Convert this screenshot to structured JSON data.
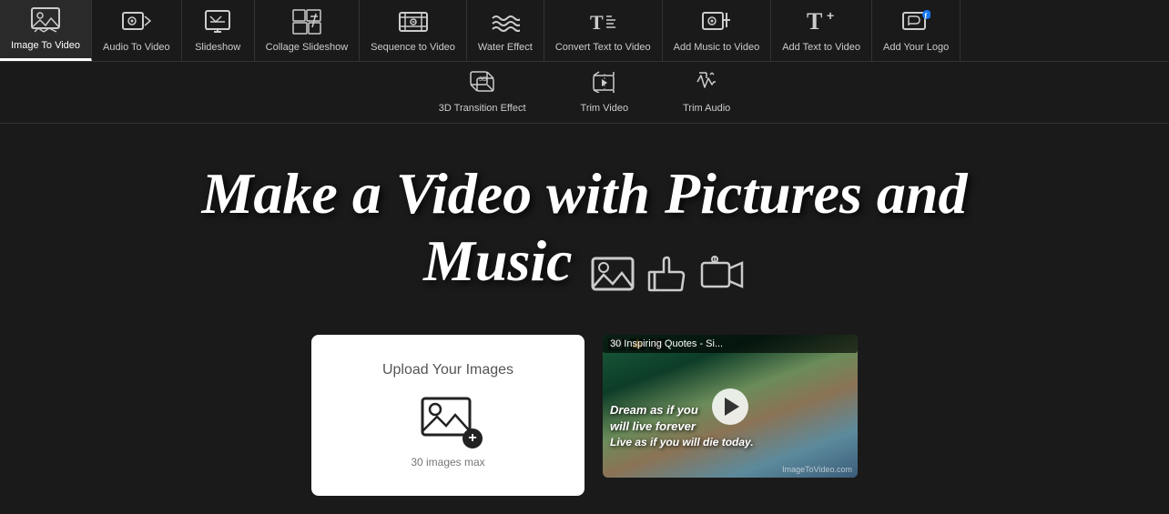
{
  "nav": {
    "items": [
      {
        "id": "image-to-video",
        "label": "Image To Video",
        "icon": "🖼",
        "active": true
      },
      {
        "id": "audio-to-video",
        "label": "Audio To Video",
        "icon": "🎵"
      },
      {
        "id": "slideshow",
        "label": "Slideshow",
        "icon": "📊"
      },
      {
        "id": "collage-slideshow",
        "label": "Collage Slideshow",
        "icon": "📋"
      },
      {
        "id": "sequence-to-video",
        "label": "Sequence to Video",
        "icon": "🎞"
      },
      {
        "id": "water-effect",
        "label": "Water Effect",
        "icon": "〰"
      },
      {
        "id": "convert-text",
        "label": "Convert Text to Video",
        "icon": "📝"
      },
      {
        "id": "add-music",
        "label": "Add Music to Video",
        "icon": "🎵"
      },
      {
        "id": "add-text",
        "label": "Add Text to Video",
        "icon": "T"
      },
      {
        "id": "add-logo",
        "label": "Add Your Logo",
        "icon": "🏷"
      }
    ]
  },
  "second_nav": {
    "items": [
      {
        "id": "3d-transition",
        "label": "3D Transition Effect",
        "icon": "✦"
      },
      {
        "id": "trim-video",
        "label": "Trim Video",
        "icon": "✂"
      },
      {
        "id": "trim-audio",
        "label": "Trim Audio",
        "icon": "🎼"
      }
    ]
  },
  "hero": {
    "title_line1": "Make a Video with Pictures and",
    "title_line2": "Music"
  },
  "upload": {
    "label": "Upload Your Images",
    "limit": "30 images max"
  },
  "video_preview": {
    "title": "30 Inspiring Quotes - Si...",
    "quote_line1": "Dream as if you",
    "quote_line2": "will live forever",
    "quote_line3": "Live as if you will die today.",
    "watermark": "ImageToVideo.com"
  }
}
